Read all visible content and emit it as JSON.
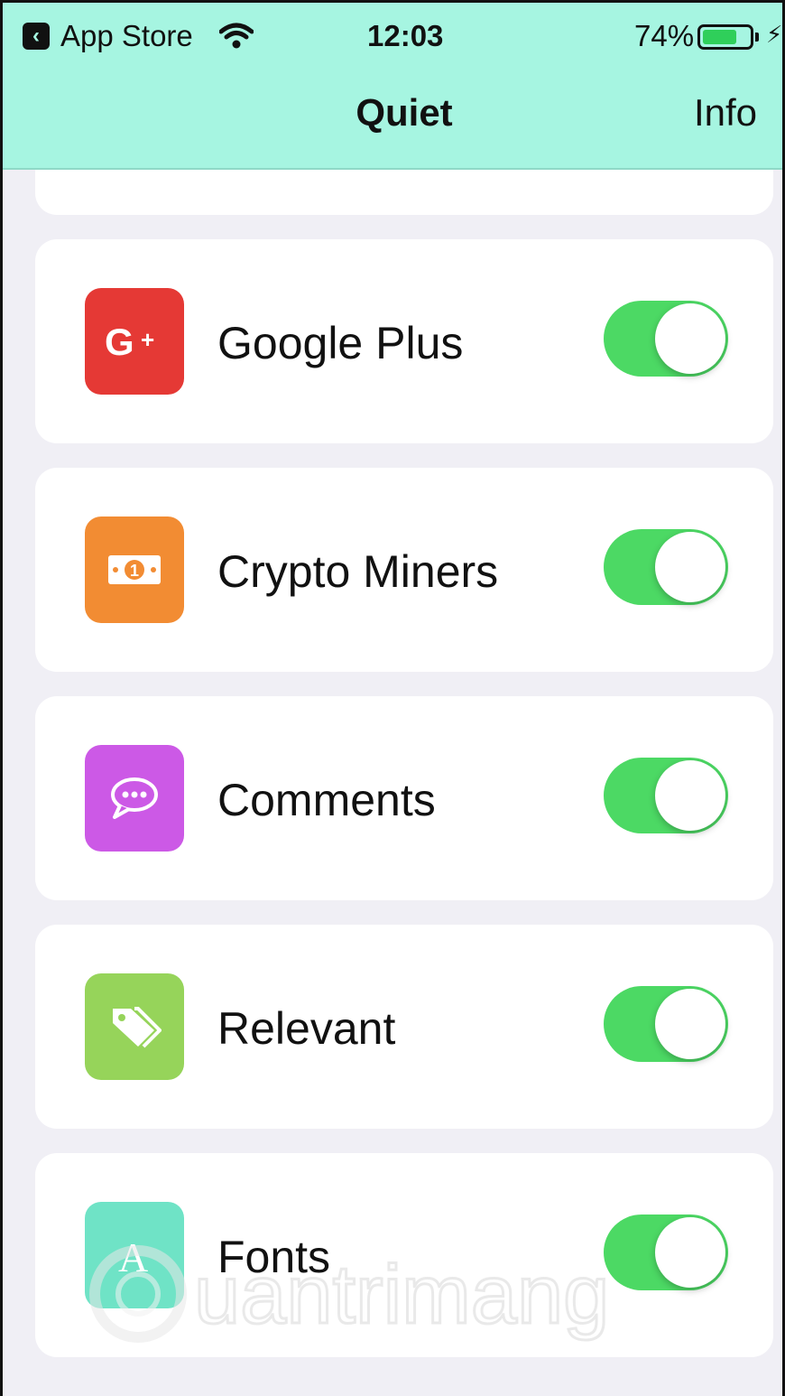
{
  "status_bar": {
    "carrier": "App Store",
    "time": "12:03",
    "battery_percent": "74%",
    "battery_level": 0.74
  },
  "nav": {
    "title": "Quiet",
    "right_button": "Info"
  },
  "colors": {
    "header_bg": "#a6f5e1",
    "toggle_on": "#4cd964",
    "google_plus": "#e53935",
    "crypto_miners": "#f28c33",
    "comments": "#cc59e6",
    "relevant": "#96d45a",
    "fonts": "#6fe3c6"
  },
  "items": [
    {
      "label": "Google Plus",
      "icon": "google-plus-icon",
      "enabled": true
    },
    {
      "label": "Crypto Miners",
      "icon": "money-bill-icon",
      "enabled": true
    },
    {
      "label": "Comments",
      "icon": "chat-bubble-icon",
      "enabled": true
    },
    {
      "label": "Relevant",
      "icon": "tag-icon",
      "enabled": true
    },
    {
      "label": "Fonts",
      "icon": "font-icon",
      "enabled": true
    }
  ],
  "watermark": "Quantrimang"
}
